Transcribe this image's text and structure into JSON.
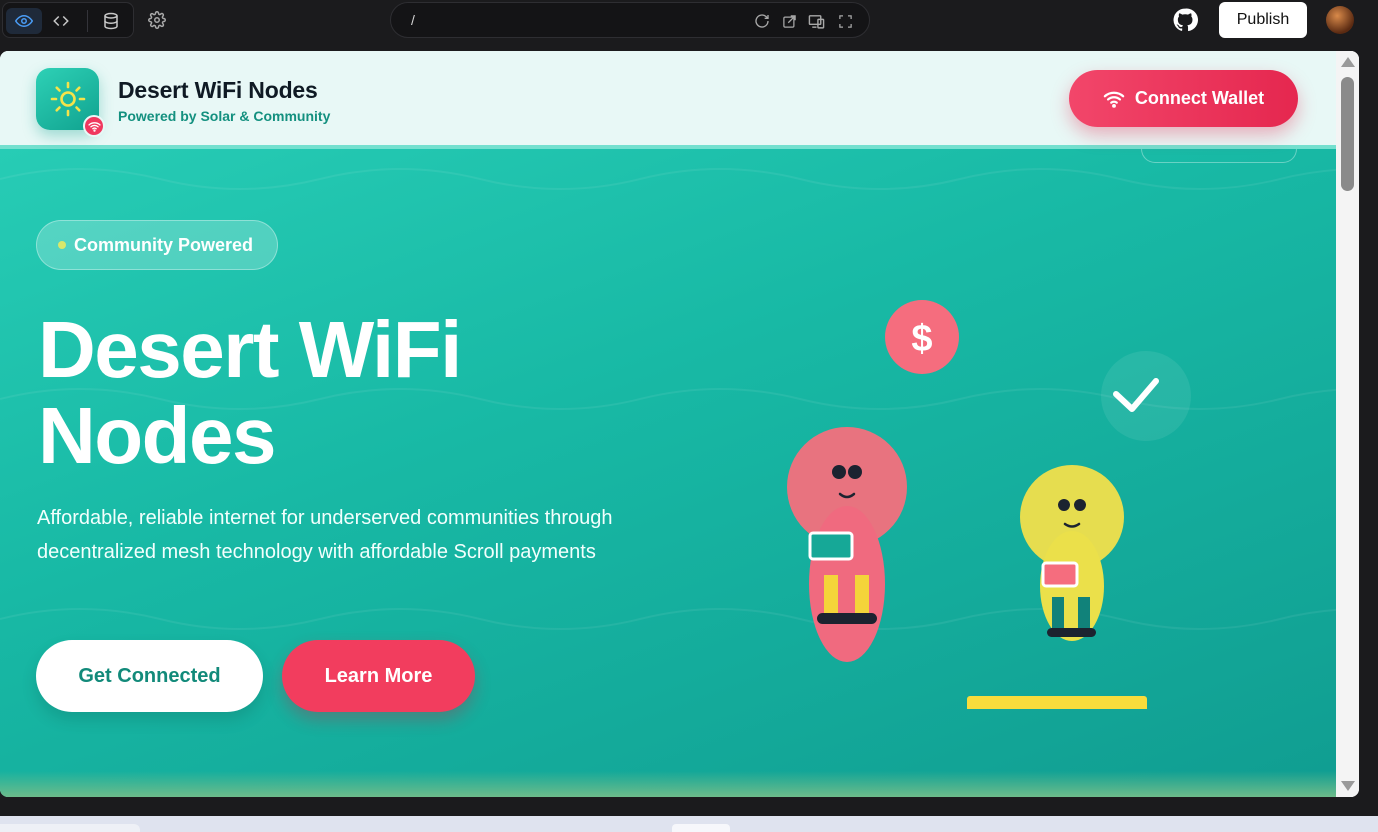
{
  "editor": {
    "url": "/",
    "publish_label": "Publish",
    "view_modes": [
      "preview-eye-icon",
      "code-icon",
      "database-icon"
    ],
    "accent": "#3b82f6"
  },
  "site": {
    "brand": {
      "title": "Desert WiFi Nodes",
      "subtitle": "Powered by Solar & Community"
    },
    "header": {
      "connect_label": "Connect Wallet"
    },
    "hero": {
      "badge": "Community Powered",
      "title_line1": "Desert WiFi",
      "title_line2": "Nodes",
      "description": "Affordable, reliable internet for underserved communities through decentralized mesh technology with affordable Scroll payments",
      "primary_cta": "Get Connected",
      "secondary_cta": "Learn More"
    },
    "illustration": {
      "coin_symbol": "$"
    },
    "colors": {
      "teal": "#18b9a5",
      "coral": "#f23d5e",
      "yellow": "#e6dd4f",
      "pink": "#e8737f"
    }
  }
}
